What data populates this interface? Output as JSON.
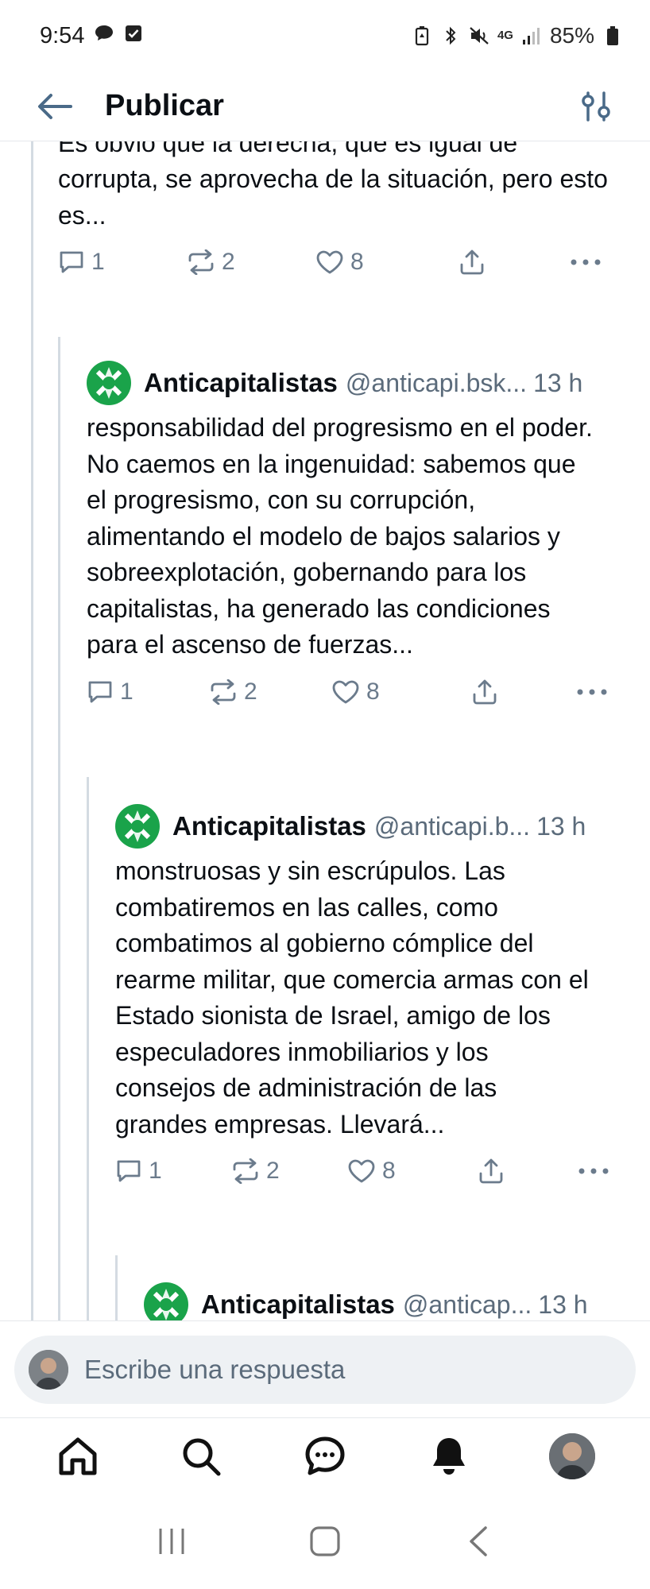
{
  "status_bar": {
    "time": "9:54",
    "battery": "85%",
    "network": "4G"
  },
  "header": {
    "title": "Publicar"
  },
  "posts": [
    {
      "text": "la putrefacción es real y está siempre presente. Es obvio que la derecha, que es igual de corrupta, se aprovecha de la situación, pero esto es...",
      "replies": "1",
      "reposts": "2",
      "likes": "8"
    },
    {
      "author": "Anticapitalistas",
      "handle": "@anticapi.bsk...",
      "time": "13 h",
      "text": "responsabilidad del progresismo en el poder. No caemos en la ingenuidad: sabemos que el progresismo, con su corrupción, alimentando el modelo de bajos salarios y sobreexplotación, gobernando para los capitalistas, ha generado las condiciones para el ascenso de fuerzas...",
      "replies": "1",
      "reposts": "2",
      "likes": "8"
    },
    {
      "author": "Anticapitalistas",
      "handle": "@anticapi.b...",
      "time": "13 h",
      "text": "monstruosas y sin escrúpulos. Las combatiremos en las calles, como combatimos al gobierno cómplice del rearme militar, que comercia armas con el Estado sionista de Israel, amigo de los especuladores inmobiliarios y los consejos de administración de las grandes empresas. Llevará...",
      "replies": "1",
      "reposts": "2",
      "likes": "8"
    },
    {
      "author": "Anticapitalistas",
      "handle": "@anticap...",
      "time": "13 h"
    }
  ],
  "reply": {
    "placeholder": "Escribe una respuesta"
  },
  "icons": {
    "back": "arrow-left-icon",
    "filter": "sliders-icon",
    "reply": "speech-bubble-icon",
    "repost": "repost-icon",
    "like": "heart-icon",
    "share": "share-icon",
    "more": "more-icon",
    "home": "home-icon",
    "search": "search-icon",
    "chat": "chat-icon",
    "notifications": "bell-icon"
  },
  "colors": {
    "logo_green": "#1aa34a",
    "muted": "#6b7b8c",
    "thread_line": "#d4dbe2"
  }
}
